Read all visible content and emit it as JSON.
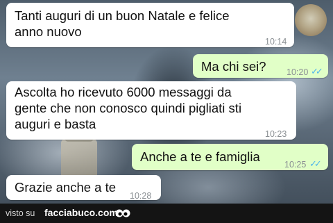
{
  "chat": {
    "messages": [
      {
        "direction": "incoming",
        "text": "Tanti auguri di un buon Natale e felice\nanno nuovo",
        "time": "10:14"
      },
      {
        "direction": "outgoing",
        "text": "Ma chi sei?",
        "time": "10:20",
        "status": "read"
      },
      {
        "direction": "incoming",
        "text": "Ascolta ho ricevuto 6000 messaggi da\ngente che non conosco quindi pigliati sti\nauguri e basta",
        "time": "10:23"
      },
      {
        "direction": "outgoing",
        "text": "Anche a te e famiglia",
        "time": "10:25",
        "status": "read"
      },
      {
        "direction": "incoming",
        "text": "Grazie anche a te",
        "time": "10:28"
      }
    ],
    "read_ticks": "✓✓",
    "colors": {
      "incoming_bubble": "#ffffff",
      "outgoing_bubble": "#e1ffc7",
      "read_tick": "#4fb6ec"
    }
  },
  "watermark": {
    "prefix": "visto su",
    "site": "facciabuco.com",
    "logo_icon": "googly-eyes-icon"
  },
  "badge": {
    "icon": "emblem-badge-icon"
  }
}
